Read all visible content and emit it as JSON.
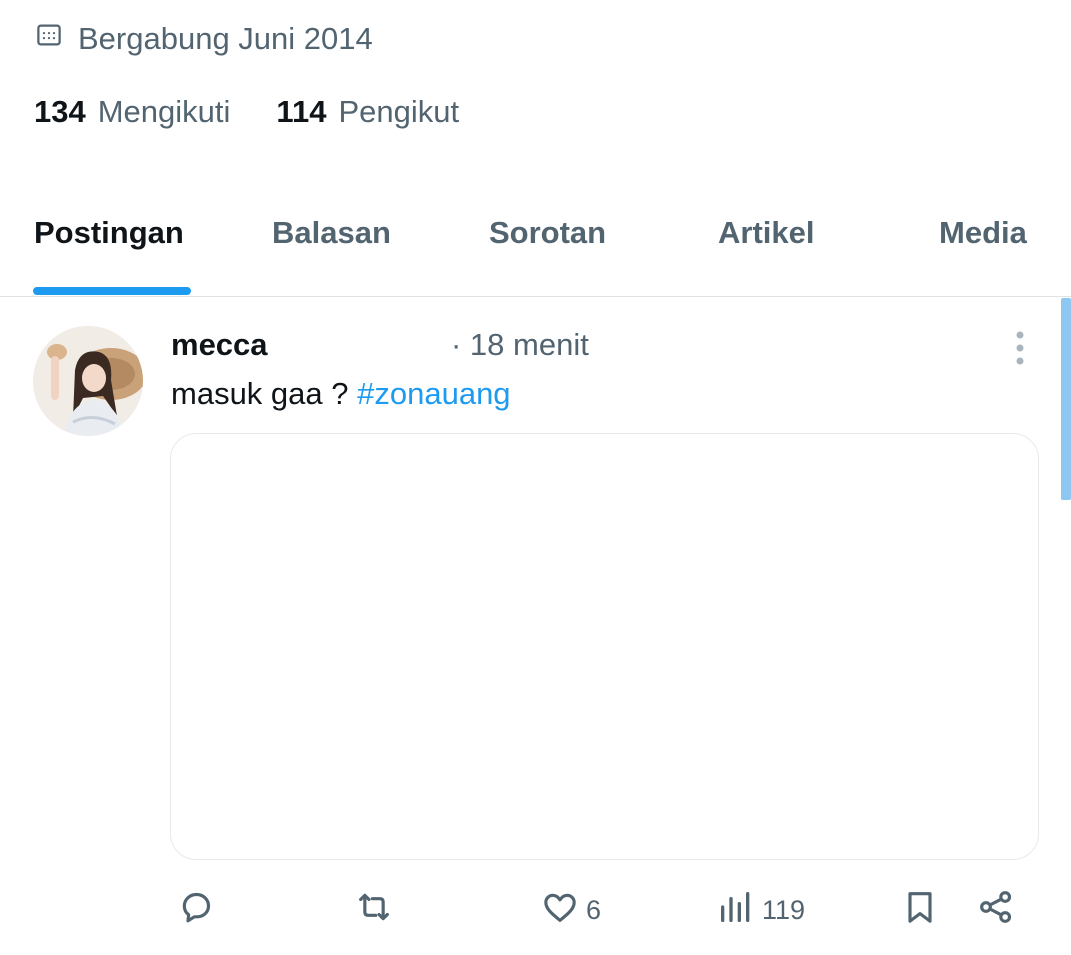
{
  "profile": {
    "joined_text": "Bergabung Juni 2014",
    "following_count": "134",
    "following_label": "Mengikuti",
    "followers_count": "114",
    "followers_label": "Pengikut"
  },
  "tabs": [
    {
      "label": "Postingan",
      "active": true
    },
    {
      "label": "Balasan",
      "active": false
    },
    {
      "label": "Sorotan",
      "active": false
    },
    {
      "label": "Artikel",
      "active": false
    },
    {
      "label": "Media",
      "active": false
    }
  ],
  "post": {
    "author": "mecca",
    "time": "· 18 menit",
    "text": "masuk gaa ?",
    "hashtag": "#zonauang",
    "likes": "6",
    "views": "119"
  },
  "icons": {
    "calendar": "calendar-icon",
    "more": "more-vertical-icon",
    "reply": "reply-icon",
    "repost": "repost-icon",
    "like": "heart-icon",
    "views": "views-icon",
    "bookmark": "bookmark-icon",
    "share": "share-icon"
  },
  "colors": {
    "accent": "#1d9bf0",
    "text_primary": "#0f1419",
    "text_secondary": "#536471",
    "border": "#dfe3e6"
  }
}
